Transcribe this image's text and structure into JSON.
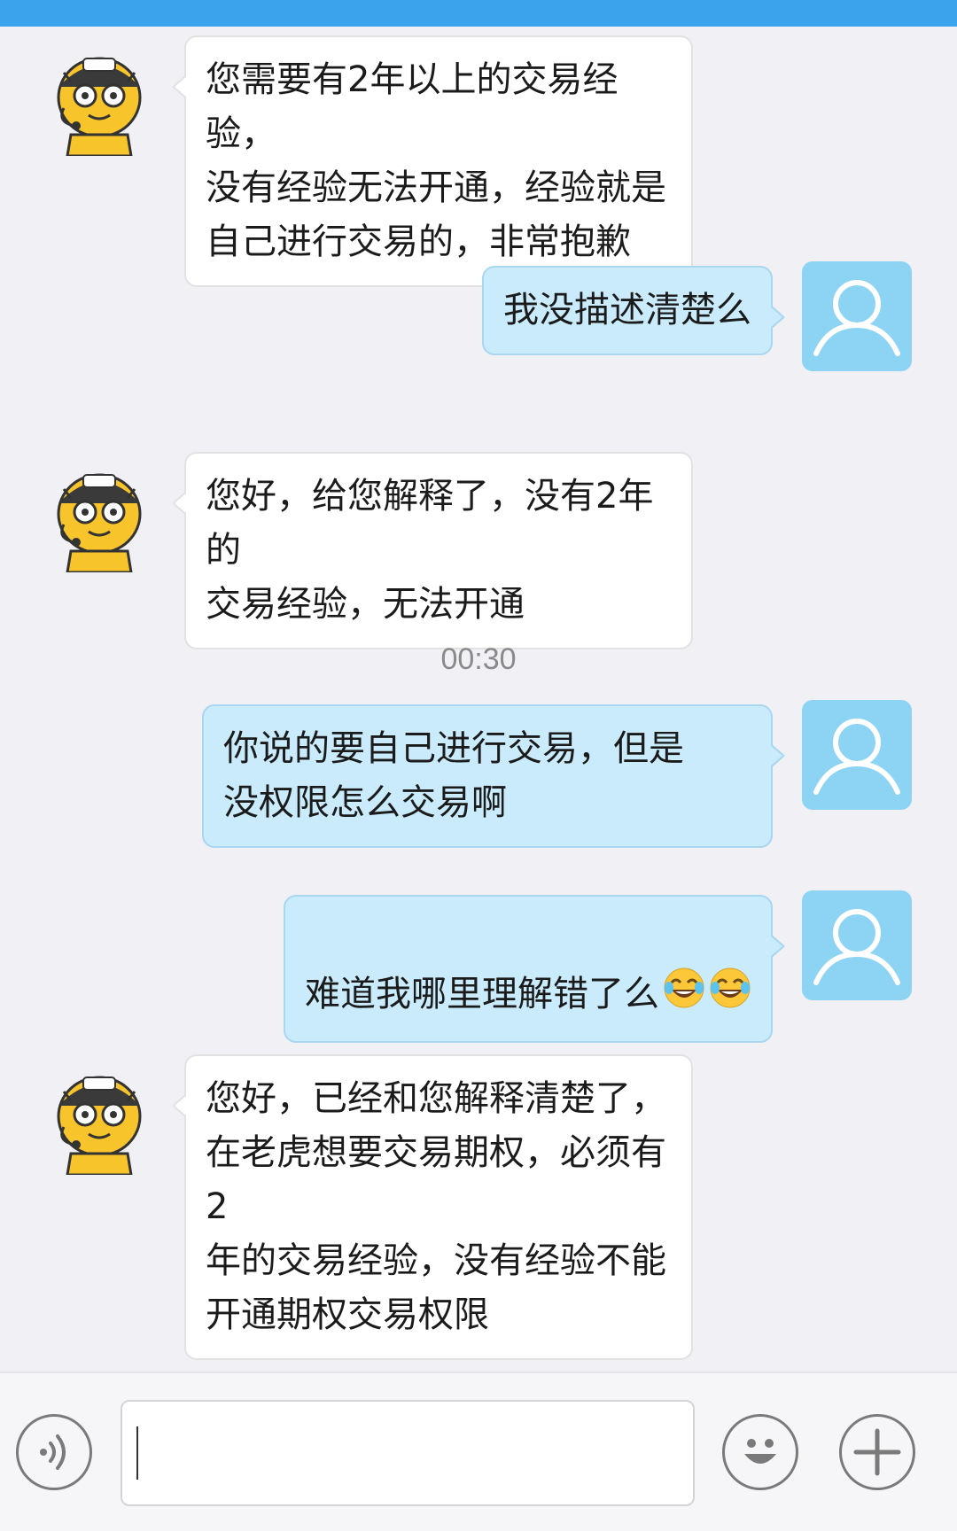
{
  "colors": {
    "topbar": "#3aa3ec",
    "background": "#f0f0f5",
    "incoming_bubble": "#ffffff",
    "outgoing_bubble": "#c9ebfb",
    "user_avatar": "#8dd4f4",
    "tiger_avatar": "#f7c52b"
  },
  "timestamp": "00:30",
  "messages": [
    {
      "side": "incoming",
      "avatar": "tiger-cs-avatar",
      "text": "您需要有2年以上的交易经验，\n没有经验无法开通，经验就是\n自己进行交易的，非常抱歉"
    },
    {
      "side": "outgoing",
      "avatar": "user-avatar",
      "text": "我没描述清楚么"
    },
    {
      "side": "incoming",
      "avatar": "tiger-cs-avatar",
      "text": "您好，给您解释了，没有2年的\n交易经验，无法开通"
    },
    {
      "side": "outgoing",
      "avatar": "user-avatar",
      "text": "你说的要自己进行交易，但是\n没权限怎么交易啊"
    },
    {
      "side": "outgoing",
      "avatar": "user-avatar",
      "text": "难道我哪里理解错了么",
      "emojis": [
        "laugh-cry-emoji",
        "laugh-cry-emoji"
      ]
    },
    {
      "side": "incoming",
      "avatar": "tiger-cs-avatar",
      "text": "您好，已经和您解释清楚了，\n在老虎想要交易期权，必须有2\n年的交易经验，没有经验不能\n开通期权交易权限"
    }
  ],
  "input_bar": {
    "value": "",
    "voice_icon": "voice-icon",
    "emoji_icon": "smiley-icon",
    "plus_icon": "plus-icon"
  }
}
